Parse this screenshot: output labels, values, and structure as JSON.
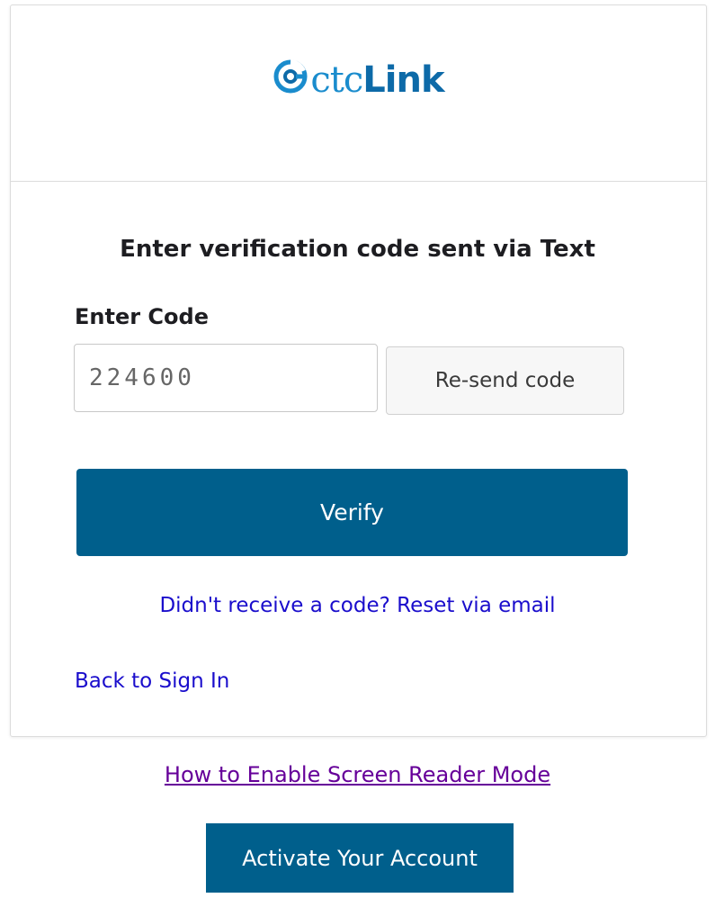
{
  "brand": {
    "logo_ctc": "ctc",
    "logo_link": "Link",
    "primary_color": "#005f8c",
    "logo_blue": "#1a8ccd",
    "link_color": "#1a0dcc",
    "visited_link_color": "#660099"
  },
  "form": {
    "title": "Enter verification code sent via Text",
    "code_label": "Enter Code",
    "code_value": "224600",
    "resend_label": "Re-send code",
    "verify_label": "Verify",
    "reset_link": "Didn't receive a code? Reset via email",
    "back_link": "Back to Sign In"
  },
  "footer": {
    "screen_reader_link": "How to Enable Screen Reader Mode",
    "activate_label": "Activate Your Account"
  }
}
